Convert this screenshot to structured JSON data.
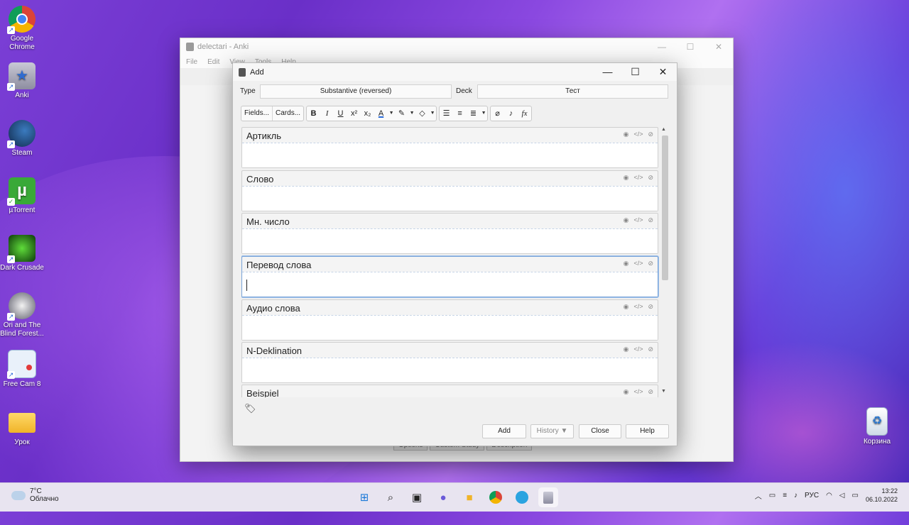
{
  "desktop": {
    "icons": [
      {
        "label": "Google Chrome",
        "glyph": "chrome-icon"
      },
      {
        "label": "Anki",
        "glyph": "anki-icon"
      },
      {
        "label": "Steam",
        "glyph": "steam-icon"
      },
      {
        "label": "µTorrent",
        "glyph": "utorrent-icon"
      },
      {
        "label": "Dark Crusade",
        "glyph": "game-icon"
      },
      {
        "label": "Ori and The Blind Forest...",
        "glyph": "game-icon"
      },
      {
        "label": "Free Cam 8",
        "glyph": "freecam-icon"
      },
      {
        "label": "Урок",
        "glyph": "folder-icon"
      },
      {
        "label": "Корзина",
        "glyph": "recycle-bin-icon"
      }
    ]
  },
  "main_window": {
    "title": "delectari - Anki",
    "menu": [
      "File",
      "Edit",
      "View",
      "Tools",
      "Help"
    ],
    "bottom_buttons": [
      "Options",
      "Custom Study",
      "Description"
    ]
  },
  "dialog": {
    "title": "Add",
    "type_label": "Type",
    "type_value": "Substantive (reversed)",
    "deck_label": "Deck",
    "deck_value": "Тест",
    "toolbar": {
      "fields_btn": "Fields...",
      "cards_btn": "Cards..."
    },
    "fields": [
      {
        "label": "Артикль",
        "focused": false
      },
      {
        "label": "Слово",
        "focused": false
      },
      {
        "label": "Мн. число",
        "focused": false
      },
      {
        "label": "Перевод слова",
        "focused": true
      },
      {
        "label": "Аудио слова",
        "focused": false
      },
      {
        "label": "N-Deklination",
        "focused": false
      },
      {
        "label": "Beispiel",
        "focused": false
      }
    ],
    "buttons": {
      "add": "Add",
      "history": "History ▼",
      "close": "Close",
      "help": "Help"
    }
  },
  "taskbar": {
    "weather_temp": "7°C",
    "weather_text": "Облачно",
    "language": "РУС",
    "time": "13:22",
    "date": "06.10.2022"
  },
  "colors": {
    "focus_border": "#7aa4d8",
    "accent_blue": "#2a6ad8"
  }
}
